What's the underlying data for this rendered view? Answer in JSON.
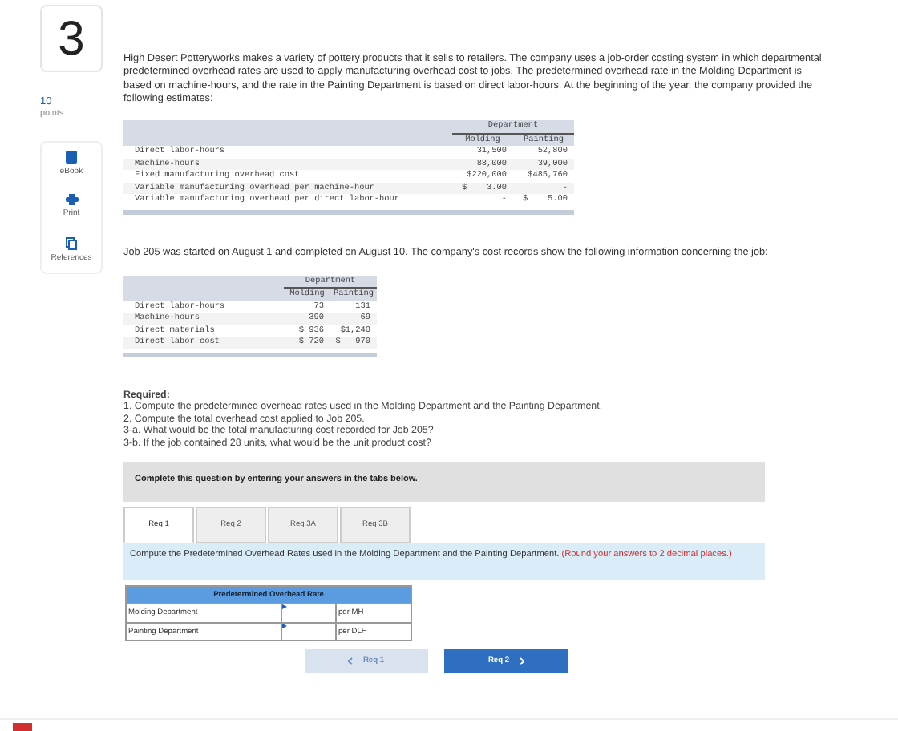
{
  "question_number": "3",
  "points": {
    "value": "10",
    "label": "points"
  },
  "tools": [
    {
      "kind": "ebook",
      "label": "eBook"
    },
    {
      "kind": "print",
      "label": "Print"
    },
    {
      "kind": "references",
      "label": "References"
    }
  ],
  "intro": "High Desert Potteryworks makes a variety of pottery products that it sells to retailers. The company uses a job-order costing system in which departmental predetermined overhead rates are used to apply manufacturing overhead cost to jobs. The predetermined overhead rate in the Molding Department is based on machine-hours, and the rate in the Painting Department is based on direct labor-hours. At the beginning of the year, the company provided the following estimates:",
  "estimates_table": {
    "group_header": "Department",
    "columns": [
      "Molding",
      "Painting"
    ],
    "rows": [
      {
        "label": "Direct labor-hours",
        "values": [
          "31,500",
          "52,800"
        ]
      },
      {
        "label": "Machine-hours",
        "values": [
          "88,000",
          "39,000"
        ]
      },
      {
        "label": "Fixed manufacturing overhead cost",
        "values": [
          "$220,000",
          "$485,760"
        ]
      },
      {
        "label": "Variable manufacturing overhead per machine-hour",
        "values": [
          "$    3.00",
          "-"
        ]
      },
      {
        "label": "Variable manufacturing overhead per direct labor-hour",
        "values": [
          "-",
          "$    5.00"
        ]
      }
    ]
  },
  "job_text": "Job 205 was started on August 1 and completed on August 10. The company's cost records show the following information concerning the job:",
  "job_table": {
    "group_header": "Department",
    "columns": [
      "Molding",
      "Painting"
    ],
    "rows": [
      {
        "label": "Direct labor-hours",
        "values": [
          "73",
          "131"
        ]
      },
      {
        "label": "Machine-hours",
        "values": [
          "390",
          "69"
        ]
      },
      {
        "label": "Direct materials",
        "values": [
          "$ 936",
          "$1,240"
        ]
      },
      {
        "label": "Direct labor cost",
        "values": [
          "$ 720",
          "$   970"
        ]
      }
    ]
  },
  "required": {
    "heading": "Required:",
    "items": [
      "1. Compute the predetermined overhead rates used in the Molding Department and the Painting Department.",
      "2. Compute the total overhead cost applied to Job 205.",
      "3-a. What would be the total manufacturing cost recorded for Job 205?",
      "3-b. If the job contained 28 units, what would be the unit product cost?"
    ]
  },
  "banner": "Complete this question by entering your answers in the tabs below.",
  "tabs": [
    {
      "label": "Req 1",
      "selected": true
    },
    {
      "label": "Req 2",
      "selected": false
    },
    {
      "label": "Req 3A",
      "selected": false
    },
    {
      "label": "Req 3B",
      "selected": false
    }
  ],
  "instruction": {
    "text": "Compute the Predetermined Overhead Rates used in the Molding Department and the Painting Department.",
    "note": "(Round your answers to 2 decimal places.)"
  },
  "answer_table": {
    "title": "Predetermined Overhead Rate",
    "rows": [
      {
        "label": "Molding Department",
        "unit": "per MH"
      },
      {
        "label": "Painting Department",
        "unit": "per DLH"
      }
    ]
  },
  "nav": [
    {
      "kind": "prev",
      "label": "Req 1",
      "disabled": true
    },
    {
      "kind": "next",
      "label": "Req 2",
      "disabled": false
    }
  ]
}
